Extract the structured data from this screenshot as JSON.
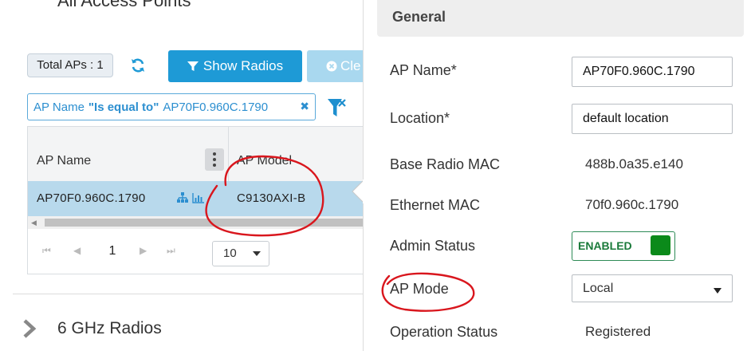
{
  "left": {
    "page_heading": "All Access Points",
    "total_aps": "Total APs : 1",
    "show_radios_label": "Show Radios",
    "clear_label": "Cle",
    "filter": {
      "field": "AP Name",
      "operator": "\"Is equal to\"",
      "value": "AP70F0.960C.1790"
    },
    "grid": {
      "columns": [
        "AP Name",
        "AP Model"
      ],
      "rows": [
        {
          "ap_name": "AP70F0.960C.1790",
          "ap_model": "C9130AXI-B"
        }
      ]
    },
    "pager": {
      "current_page": "1",
      "page_size": "10"
    },
    "section_label": "6 GHz Radios"
  },
  "right": {
    "section_title": "General",
    "fields": {
      "ap_name_label": "AP Name*",
      "ap_name_value": "AP70F0.960C.1790",
      "location_label": "Location*",
      "location_value": "default location",
      "base_radio_mac_label": "Base Radio MAC",
      "base_radio_mac_value": "488b.0a35.e140",
      "ethernet_mac_label": "Ethernet MAC",
      "ethernet_mac_value": "70f0.960c.1790",
      "admin_status_label": "Admin Status",
      "admin_status_value": "ENABLED",
      "ap_mode_label": "AP Mode",
      "ap_mode_value": "Local",
      "operation_status_label": "Operation Status",
      "operation_status_value": "Registered"
    }
  },
  "colors": {
    "primary_button": "#1e9ad6",
    "selected_row": "#b8d9ec",
    "enabled_green": "#0b8a1a",
    "annotation_red": "#d9161d"
  },
  "icons": [
    "refresh-icon",
    "funnel-icon",
    "filter-clear-icon",
    "close-icon",
    "topology-icon",
    "chart-icon",
    "chevron-right-icon",
    "caret-down-icon"
  ]
}
